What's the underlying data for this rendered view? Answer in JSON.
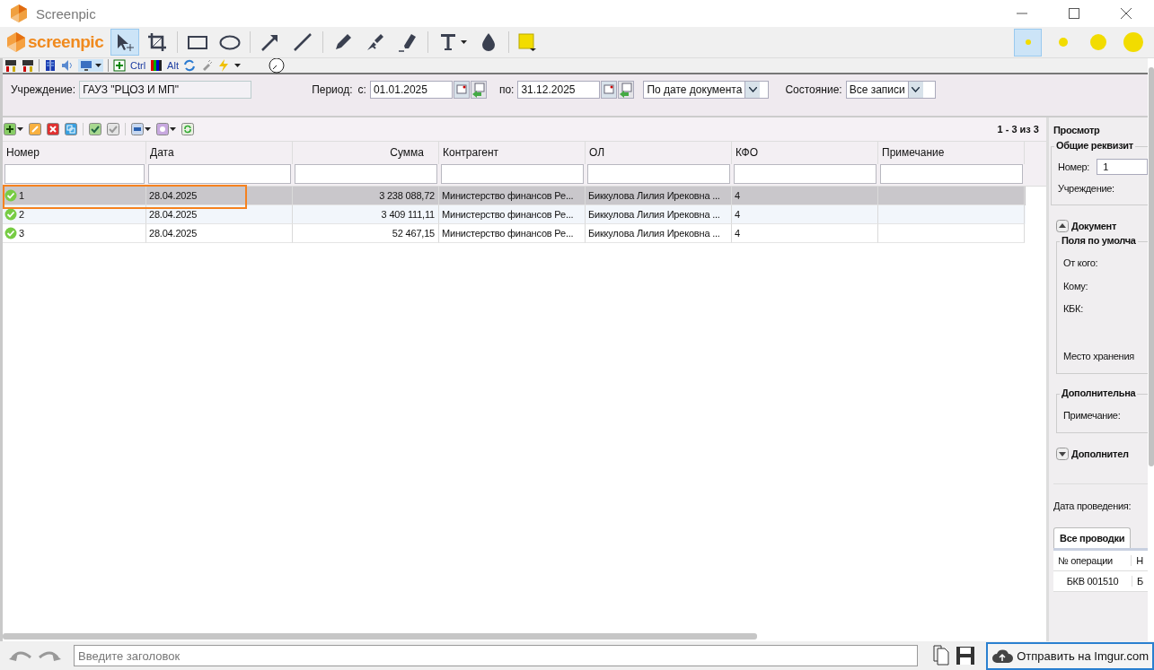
{
  "window": {
    "title": "Screenpic"
  },
  "toolbar": {
    "logo": "screenpic",
    "color": "#f2dc00",
    "tools": [
      {
        "kind": "select",
        "selected": true
      },
      {
        "kind": "crop",
        "selected": false
      },
      {
        "kind": "rectangle",
        "selected": false
      },
      {
        "kind": "ellipse",
        "selected": false
      },
      {
        "kind": "arrow",
        "selected": false
      },
      {
        "kind": "line",
        "selected": false
      },
      {
        "kind": "pencil",
        "selected": false
      },
      {
        "kind": "brush",
        "selected": false
      },
      {
        "kind": "marker",
        "selected": false
      },
      {
        "kind": "text",
        "selected": false
      },
      {
        "kind": "drop",
        "selected": false
      }
    ],
    "sizes": [
      {
        "selected": true
      },
      {
        "selected": false
      },
      {
        "selected": false
      },
      {
        "selected": false
      }
    ]
  },
  "capture": {
    "hotkeys": [
      "Ctrl",
      "Alt"
    ],
    "filters": {
      "institution_label": "Учреждение:",
      "institution": "ГАУЗ \"РЦОЗ И МП\"",
      "period_label": "Период:",
      "from_label": "с:",
      "from": "01.01.2025",
      "to_label": "по:",
      "to": "31.12.2025",
      "date_mode": "По дате документа",
      "state_label": "Состояние:",
      "state": "Все записи"
    },
    "pager": "1 - 3 из 3",
    "table": {
      "columns": [
        {
          "label": "Номер"
        },
        {
          "label": "Дата"
        },
        {
          "label": "Сумма"
        },
        {
          "label": "Контрагент"
        },
        {
          "label": "ОЛ"
        },
        {
          "label": "КФО"
        },
        {
          "label": "Примечание"
        }
      ],
      "rows": [
        {
          "selected": true,
          "cells": [
            "1",
            "28.04.2025",
            "3 238 088,72",
            "Министерство финансов Ре...",
            "Биккулова Лилия Ирековна ...",
            "4"
          ]
        },
        {
          "selected": false,
          "cells": [
            "2",
            "28.04.2025",
            "3 409 111,11",
            "Министерство финансов Ре...",
            "Биккулова Лилия Ирековна ...",
            "4"
          ]
        },
        {
          "selected": false,
          "cells": [
            "3",
            "28.04.2025",
            "52 467,15",
            "Министерство финансов Ре...",
            "Биккулова Лилия Ирековна ...",
            "4"
          ]
        }
      ]
    },
    "panel": {
      "title": "Просмотр",
      "general": {
        "legend": "Общие реквизит",
        "number_label": "Номер:",
        "number": "1",
        "institution_label": "Учреждение:"
      },
      "document": {
        "legend": "Документ",
        "expanded": true,
        "defaults": {
          "legend": "Поля по умолча",
          "fields": [
            "От кого:",
            "Кому:",
            "КБК:",
            "Место хранения"
          ]
        },
        "extra": {
          "legend": "Дополнительна",
          "fields": [
            "Примечание:"
          ]
        }
      },
      "extra_section": {
        "legend": "Дополнител",
        "expanded": false
      },
      "posting_date_label": "Дата проведения:",
      "tabs": [
        {
          "label": "Все проводки",
          "selected": true
        }
      ],
      "postings": {
        "columns": [
          "№ операции",
          "Н"
        ],
        "rows": [
          [
            "БКВ 001510",
            "Б"
          ]
        ]
      }
    }
  },
  "bottom": {
    "title_placeholder": "Введите заголовок",
    "upload": "Отправить на Imgur.com"
  }
}
